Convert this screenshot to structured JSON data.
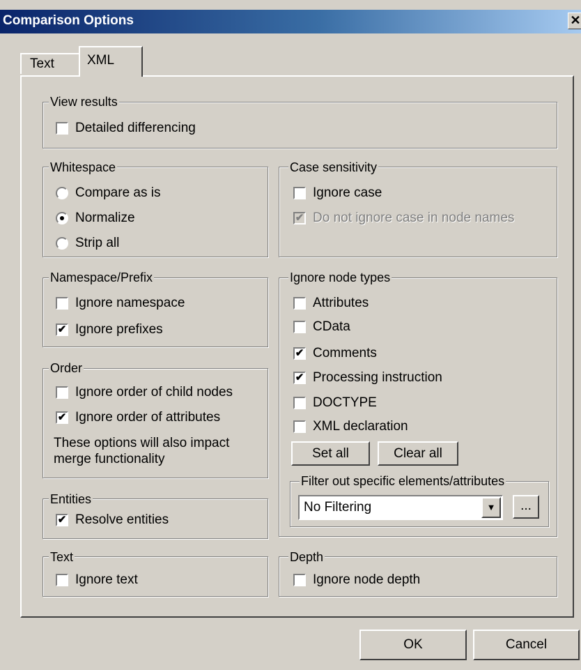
{
  "window": {
    "title": "Comparison Options",
    "close_glyph": "✕"
  },
  "tabs": [
    {
      "label": "Text",
      "selected": false
    },
    {
      "label": "XML",
      "selected": true
    }
  ],
  "view_results": {
    "legend": "View results",
    "detailed_differencing": {
      "label": "Detailed differencing",
      "checked": false
    }
  },
  "whitespace": {
    "legend": "Whitespace",
    "options": [
      {
        "label": "Compare as is",
        "selected": false
      },
      {
        "label": "Normalize",
        "selected": true
      },
      {
        "label": "Strip all",
        "selected": false
      }
    ]
  },
  "case_sensitivity": {
    "legend": "Case sensitivity",
    "ignore_case": {
      "label": "Ignore case",
      "checked": false
    },
    "node_names": {
      "label": "Do not ignore case in node names",
      "checked": true,
      "disabled": true
    }
  },
  "namespace_prefix": {
    "legend": "Namespace/Prefix",
    "ignore_namespace": {
      "label": "Ignore namespace",
      "checked": false
    },
    "ignore_prefixes": {
      "label": "Ignore prefixes",
      "checked": true
    }
  },
  "ignore_node_types": {
    "legend": "Ignore node types",
    "items": [
      {
        "label": "Attributes",
        "checked": false
      },
      {
        "label": "CData",
        "checked": false
      },
      {
        "label": "Comments",
        "checked": true
      },
      {
        "label": "Processing instruction",
        "checked": true
      },
      {
        "label": "DOCTYPE",
        "checked": false
      },
      {
        "label": "XML declaration",
        "checked": false
      }
    ],
    "set_all_label": "Set all",
    "clear_all_label": "Clear all",
    "filter": {
      "legend": "Filter out specific elements/attributes",
      "selected_value": "No Filtering",
      "browse_label": "..."
    }
  },
  "order": {
    "legend": "Order",
    "child_nodes": {
      "label": "Ignore order of child nodes",
      "checked": false
    },
    "attributes": {
      "label": "Ignore order of attributes",
      "checked": true
    },
    "note_line1": "These options will also impact",
    "note_line2": "merge functionality"
  },
  "entities": {
    "legend": "Entities",
    "resolve": {
      "label": "Resolve entities",
      "checked": true
    }
  },
  "text_group": {
    "legend": "Text",
    "ignore_text": {
      "label": "Ignore text",
      "checked": false
    }
  },
  "depth": {
    "legend": "Depth",
    "ignore_depth": {
      "label": "Ignore node depth",
      "checked": false
    }
  },
  "footer": {
    "ok_label": "OK",
    "cancel_label": "Cancel"
  },
  "glyphs": {
    "check": "✔",
    "dropdown_arrow": "▼"
  }
}
